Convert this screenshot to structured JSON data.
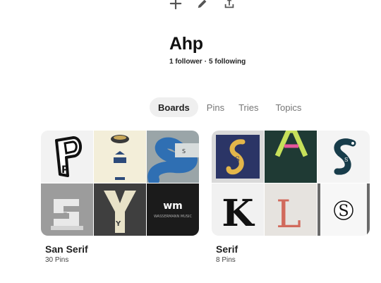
{
  "toolbar": {
    "icons": [
      "plus-icon",
      "pencil-icon",
      "share-icon"
    ]
  },
  "profile": {
    "name": "Ahp",
    "followers": "1 follower",
    "separator": "·",
    "following": "5 following"
  },
  "tabs": [
    {
      "label": "Boards",
      "active": true
    },
    {
      "label": "Pins",
      "active": false
    },
    {
      "label": "Tries",
      "active": false
    },
    {
      "label": "Topics",
      "active": false
    }
  ],
  "boards": [
    {
      "title": "San Serif",
      "count": "30 Pins",
      "thumbnail_letters": [
        "P",
        "Y",
        "S",
        "S",
        "wm"
      ],
      "thumbnail_caption": "WASSERMANN MUSIC"
    },
    {
      "title": "Serif",
      "count": "8 Pins",
      "thumbnail_letters": [
        "S",
        "A",
        "S",
        "K",
        "L",
        "S"
      ]
    }
  ],
  "colors": {
    "tab_active_bg": "#efefef",
    "text_primary": "#111111",
    "text_muted": "#767676"
  }
}
